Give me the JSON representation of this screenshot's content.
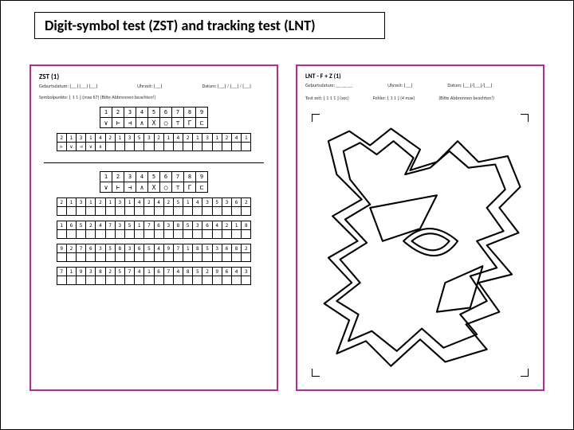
{
  "title": "Digit-symbol test (ZST) and tracking test (LNT)",
  "zst": {
    "heading": "ZST (1)",
    "meta_left": "Geburtsdatum: ⌊__⌋ ⌊__⌋ ⌊__⌋",
    "meta_mid": "Uhrzeit: ⌊__⌋",
    "meta_right": "Datum: ⌊__⌋ / ⌊__⌋ / ⌊__⌋",
    "points_line": "Symbolpunkte:  ⌊ 1 1 ⌋  (max 67)        (Bitte Abbrennen beachten!)",
    "key_digits": [
      "1",
      "2",
      "3",
      "4",
      "5",
      "6",
      "7",
      "8",
      "9"
    ],
    "key_symbols": [
      "∨",
      "⊢",
      "⊣",
      "∧",
      "X",
      "○",
      "⊤",
      "Г",
      "⊏"
    ],
    "strip1_digits": [
      "2",
      "1",
      "3",
      "1",
      "4",
      "2",
      "1",
      "3",
      "5",
      "3",
      "2",
      "1",
      "4",
      "2",
      "1",
      "3",
      "1",
      "2",
      "4",
      "1"
    ],
    "strip1_syms": [
      "⊢",
      "∨",
      "⊣",
      "∨",
      "∧",
      "",
      "",
      "",
      "",
      "",
      "",
      "",
      "",
      "",
      "",
      "",
      "",
      "",
      "",
      ""
    ],
    "key2_digits": [
      "1",
      "2",
      "3",
      "4",
      "5",
      "6",
      "7",
      "8",
      "9"
    ],
    "key2_symbols": [
      "∨",
      "⊢",
      "⊣",
      "∧",
      "X",
      "○",
      "⊤",
      "Г",
      "⊏"
    ],
    "rows": [
      [
        "2",
        "1",
        "3",
        "1",
        "2",
        "1",
        "3",
        "1",
        "4",
        "2",
        "4",
        "2",
        "5",
        "1",
        "4",
        "3",
        "5",
        "3",
        "6",
        "2"
      ],
      [
        "1",
        "6",
        "5",
        "2",
        "4",
        "7",
        "3",
        "5",
        "1",
        "7",
        "6",
        "3",
        "8",
        "5",
        "3",
        "6",
        "4",
        "2",
        "1",
        "8"
      ],
      [
        "9",
        "2",
        "7",
        "6",
        "3",
        "5",
        "8",
        "3",
        "6",
        "5",
        "4",
        "9",
        "7",
        "1",
        "8",
        "5",
        "3",
        "6",
        "8",
        "2"
      ],
      [
        "7",
        "1",
        "9",
        "3",
        "8",
        "2",
        "5",
        "7",
        "4",
        "1",
        "6",
        "7",
        "4",
        "8",
        "5",
        "2",
        "9",
        "6",
        "4",
        "3"
      ]
    ]
  },
  "lnt": {
    "heading": "LNT - F + Z (1)",
    "meta_mid": "Uhrzeit: ⌊__⌋",
    "meta_right": "Datum: ⌊__⌋/⌊__⌋/⌊__⌋",
    "sub_left": "Geburtsdatum: __ __ __",
    "sub_time": "Test zeit:  ⌊ 1 1 1 ⌋ (sec)",
    "sub_err": "Fehler: ⌊ 1 1 ⌋ (4 max)",
    "sub_note": "(Bitte Abbrennen beachten!)"
  }
}
